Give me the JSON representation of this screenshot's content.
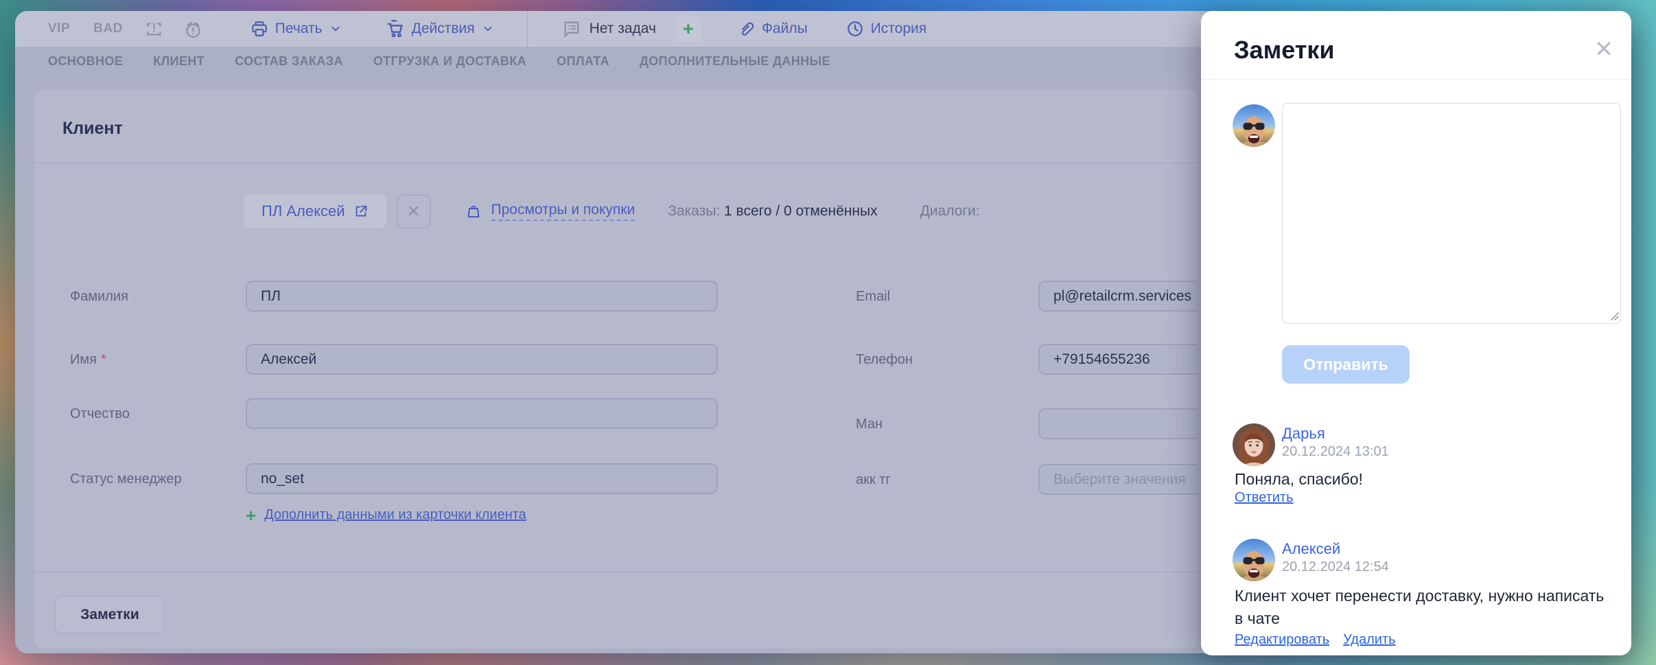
{
  "toolbar": {
    "vip_badge": "VIP",
    "bad_badge": "BAD",
    "print_label": "Печать",
    "actions_label": "Действия",
    "no_tasks_label": "Нет задач",
    "add_task_label": "+",
    "files_label": "Файлы",
    "history_label": "История"
  },
  "tabs": [
    "ОСНОВНОЕ",
    "КЛИЕНТ",
    "СОСТАВ ЗАКАЗА",
    "ОТГРУЗКА И ДОСТАВКА",
    "ОПЛАТА",
    "ДОПОЛНИТЕЛЬНЫЕ ДАННЫЕ"
  ],
  "client": {
    "title": "Клиент",
    "chip_label": "ПЛ Алексей",
    "views_purchases_link": "Просмотры и покупки",
    "orders_label": "Заказы:",
    "orders_value": "1 всего / 0 отменённых",
    "dialogs_label": "Диалоги:",
    "required_mark": "*",
    "fields_left": [
      {
        "label": "Фамилия",
        "value": "ПЛ"
      },
      {
        "label": "Имя",
        "value": "Алексей",
        "required": true
      },
      {
        "label": "Отчество",
        "value": ""
      },
      {
        "label": "Статус менеджер",
        "value": "no_set"
      }
    ],
    "fields_right": [
      {
        "label": "Email",
        "value": "pl@retailcrm.services"
      },
      {
        "label": "Телефон",
        "value": "+79154655236"
      },
      {
        "label": "Ман",
        "value": ""
      },
      {
        "label": "акк тг",
        "value": "",
        "placeholder": "Выберите значения"
      }
    ],
    "enrich_link": "Дополнить данными из карточки клиента",
    "notes_button_label": "Заметки"
  },
  "notes_panel": {
    "title": "Заметки",
    "send_button_label": "Отправить",
    "notes": [
      {
        "author": "Дарья",
        "timestamp": "20.12.2024 13:01",
        "text": "Поняла, спасибо!",
        "actions": [
          "Ответить"
        ]
      },
      {
        "author": "Алексей",
        "timestamp": "20.12.2024 12:54",
        "text": "Клиент хочет перенести доставку, нужно написать в чате",
        "actions": [
          "Редактировать",
          "Удалить"
        ]
      }
    ]
  },
  "colors": {
    "accent_blue_dimmed": "#4a5cc0",
    "panel_link_blue": "#2c63e3",
    "send_disabled_bg": "#b7d2f9",
    "green_plus": "#3d9e6b",
    "required_red": "#c0506a"
  }
}
